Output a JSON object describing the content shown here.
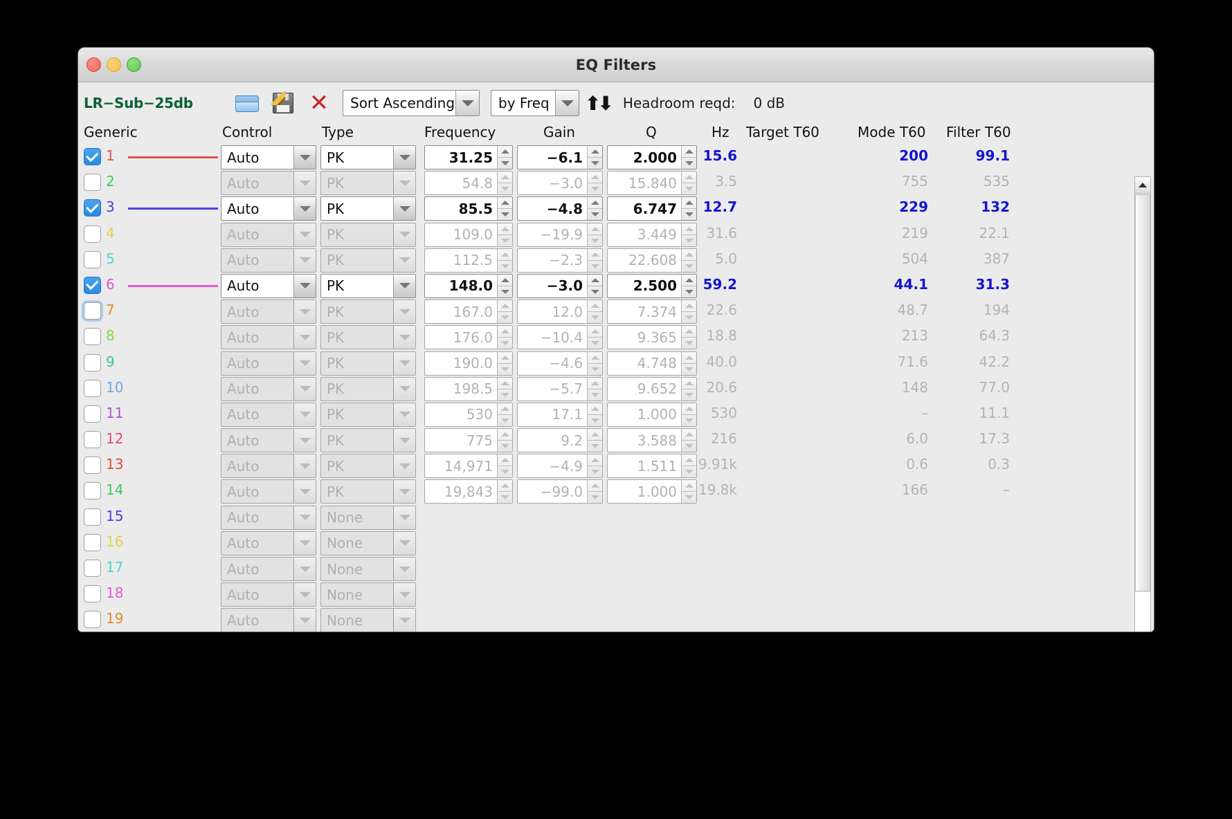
{
  "window": {
    "title": "EQ Filters",
    "traffic_lights": [
      "close-button",
      "minimize-button",
      "zoom-button"
    ]
  },
  "toolbar": {
    "preset_name": "LR−Sub−25db",
    "open_icon": "folder-open-icon",
    "save_icon": "save-icon",
    "delete_icon": "delete-x-icon",
    "sort_order": "Sort Ascending",
    "sort_by": "by Freq",
    "sort_direction_icon": "sort-direction-icon",
    "headroom_label": "Headroom reqd:",
    "headroom_value": "0 dB"
  },
  "table": {
    "headers": {
      "generic": "Generic",
      "control": "Control",
      "type": "Type",
      "frequency": "Frequency",
      "gain": "Gain",
      "q": "Q",
      "hz": "Hz",
      "target_t60": "Target T60",
      "mode_t60": "Mode T60",
      "filter_t60": "Filter T60"
    },
    "rows": [
      {
        "num": "1",
        "color": "#d9534f",
        "checked": true,
        "focused": false,
        "active": true,
        "line": true,
        "control": "Auto",
        "type": "PK",
        "frequency": "31.25",
        "gain": "−6.1",
        "q": "2.000",
        "hz": "15.6",
        "target_t60": "",
        "mode_t60": "200",
        "filter_t60": "99.1"
      },
      {
        "num": "2",
        "color": "#41c85a",
        "checked": false,
        "focused": false,
        "active": false,
        "line": false,
        "control": "Auto",
        "type": "PK",
        "frequency": "54.8",
        "gain": "−3.0",
        "q": "15.840",
        "hz": "3.5",
        "target_t60": "",
        "mode_t60": "755",
        "filter_t60": "535"
      },
      {
        "num": "3",
        "color": "#4a41e0",
        "checked": true,
        "focused": false,
        "active": true,
        "line": true,
        "control": "Auto",
        "type": "PK",
        "frequency": "85.5",
        "gain": "−4.8",
        "q": "6.747",
        "hz": "12.7",
        "target_t60": "",
        "mode_t60": "229",
        "filter_t60": "132"
      },
      {
        "num": "4",
        "color": "#e0d24a",
        "checked": false,
        "focused": false,
        "active": false,
        "line": false,
        "control": "Auto",
        "type": "PK",
        "frequency": "109.0",
        "gain": "−19.9",
        "q": "3.449",
        "hz": "31.6",
        "target_t60": "",
        "mode_t60": "219",
        "filter_t60": "22.1"
      },
      {
        "num": "5",
        "color": "#49d6d0",
        "checked": false,
        "focused": false,
        "active": false,
        "line": false,
        "control": "Auto",
        "type": "PK",
        "frequency": "112.5",
        "gain": "−2.3",
        "q": "22.608",
        "hz": "5.0",
        "target_t60": "",
        "mode_t60": "504",
        "filter_t60": "387"
      },
      {
        "num": "6",
        "color": "#e05ad0",
        "checked": true,
        "focused": false,
        "active": true,
        "line": true,
        "control": "Auto",
        "type": "PK",
        "frequency": "148.0",
        "gain": "−3.0",
        "q": "2.500",
        "hz": "59.2",
        "target_t60": "",
        "mode_t60": "44.1",
        "filter_t60": "31.3"
      },
      {
        "num": "7",
        "color": "#e08a2e",
        "checked": false,
        "focused": true,
        "active": false,
        "line": false,
        "control": "Auto",
        "type": "PK",
        "frequency": "167.0",
        "gain": "12.0",
        "q": "7.374",
        "hz": "22.6",
        "target_t60": "",
        "mode_t60": "48.7",
        "filter_t60": "194"
      },
      {
        "num": "8",
        "color": "#86d94a",
        "checked": false,
        "focused": false,
        "active": false,
        "line": false,
        "control": "Auto",
        "type": "PK",
        "frequency": "176.0",
        "gain": "−10.4",
        "q": "9.365",
        "hz": "18.8",
        "target_t60": "",
        "mode_t60": "213",
        "filter_t60": "64.3"
      },
      {
        "num": "9",
        "color": "#3fc98a",
        "checked": false,
        "focused": false,
        "active": false,
        "line": false,
        "control": "Auto",
        "type": "PK",
        "frequency": "190.0",
        "gain": "−4.6",
        "q": "4.748",
        "hz": "40.0",
        "target_t60": "",
        "mode_t60": "71.6",
        "filter_t60": "42.2"
      },
      {
        "num": "10",
        "color": "#6fa8dc",
        "checked": false,
        "focused": false,
        "active": false,
        "line": false,
        "control": "Auto",
        "type": "PK",
        "frequency": "198.5",
        "gain": "−5.7",
        "q": "9.652",
        "hz": "20.6",
        "target_t60": "",
        "mode_t60": "148",
        "filter_t60": "77.0"
      },
      {
        "num": "11",
        "color": "#a855d6",
        "checked": false,
        "focused": false,
        "active": false,
        "line": false,
        "control": "Auto",
        "type": "PK",
        "frequency": "530",
        "gain": "17.1",
        "q": "1.000",
        "hz": "530",
        "target_t60": "",
        "mode_t60": "–",
        "filter_t60": "11.1"
      },
      {
        "num": "12",
        "color": "#e0477f",
        "checked": false,
        "focused": false,
        "active": false,
        "line": false,
        "control": "Auto",
        "type": "PK",
        "frequency": "775",
        "gain": "9.2",
        "q": "3.588",
        "hz": "216",
        "target_t60": "",
        "mode_t60": "6.0",
        "filter_t60": "17.3"
      },
      {
        "num": "13",
        "color": "#e8483f",
        "checked": false,
        "focused": false,
        "active": false,
        "line": false,
        "control": "Auto",
        "type": "PK",
        "frequency": "14,971",
        "gain": "−4.9",
        "q": "1.511",
        "hz": "9.91k",
        "target_t60": "",
        "mode_t60": "0.6",
        "filter_t60": "0.3"
      },
      {
        "num": "14",
        "color": "#41c85a",
        "checked": false,
        "focused": false,
        "active": false,
        "line": false,
        "control": "Auto",
        "type": "PK",
        "frequency": "19,843",
        "gain": "−99.0",
        "q": "1.000",
        "hz": "19.8k",
        "target_t60": "",
        "mode_t60": "166",
        "filter_t60": "–"
      },
      {
        "num": "15",
        "color": "#4a41e0",
        "checked": false,
        "focused": false,
        "active": false,
        "line": false,
        "control": "Auto",
        "type": "None",
        "frequency": "",
        "gain": "",
        "q": "",
        "hz": "",
        "target_t60": "",
        "mode_t60": "",
        "filter_t60": ""
      },
      {
        "num": "16",
        "color": "#e0d24a",
        "checked": false,
        "focused": false,
        "active": false,
        "line": false,
        "control": "Auto",
        "type": "None",
        "frequency": "",
        "gain": "",
        "q": "",
        "hz": "",
        "target_t60": "",
        "mode_t60": "",
        "filter_t60": ""
      },
      {
        "num": "17",
        "color": "#49d6d0",
        "checked": false,
        "focused": false,
        "active": false,
        "line": false,
        "control": "Auto",
        "type": "None",
        "frequency": "",
        "gain": "",
        "q": "",
        "hz": "",
        "target_t60": "",
        "mode_t60": "",
        "filter_t60": ""
      },
      {
        "num": "18",
        "color": "#e05ad0",
        "checked": false,
        "focused": false,
        "active": false,
        "line": false,
        "control": "Auto",
        "type": "None",
        "frequency": "",
        "gain": "",
        "q": "",
        "hz": "",
        "target_t60": "",
        "mode_t60": "",
        "filter_t60": ""
      },
      {
        "num": "19",
        "color": "#e08a2e",
        "checked": false,
        "focused": false,
        "active": false,
        "line": false,
        "control": "Auto",
        "type": "None",
        "frequency": "",
        "gain": "",
        "q": "",
        "hz": "",
        "target_t60": "",
        "mode_t60": "",
        "filter_t60": ""
      }
    ]
  },
  "scrollbar": {
    "up_arrow": "scroll-up-arrow",
    "down_arrow": "scroll-down-arrow"
  },
  "colors": {
    "active_value": "#1515cf",
    "dim_value": "#b3b3b3",
    "preset_name": "#0a6134",
    "checkbox_checked": "#2b8ae0"
  }
}
